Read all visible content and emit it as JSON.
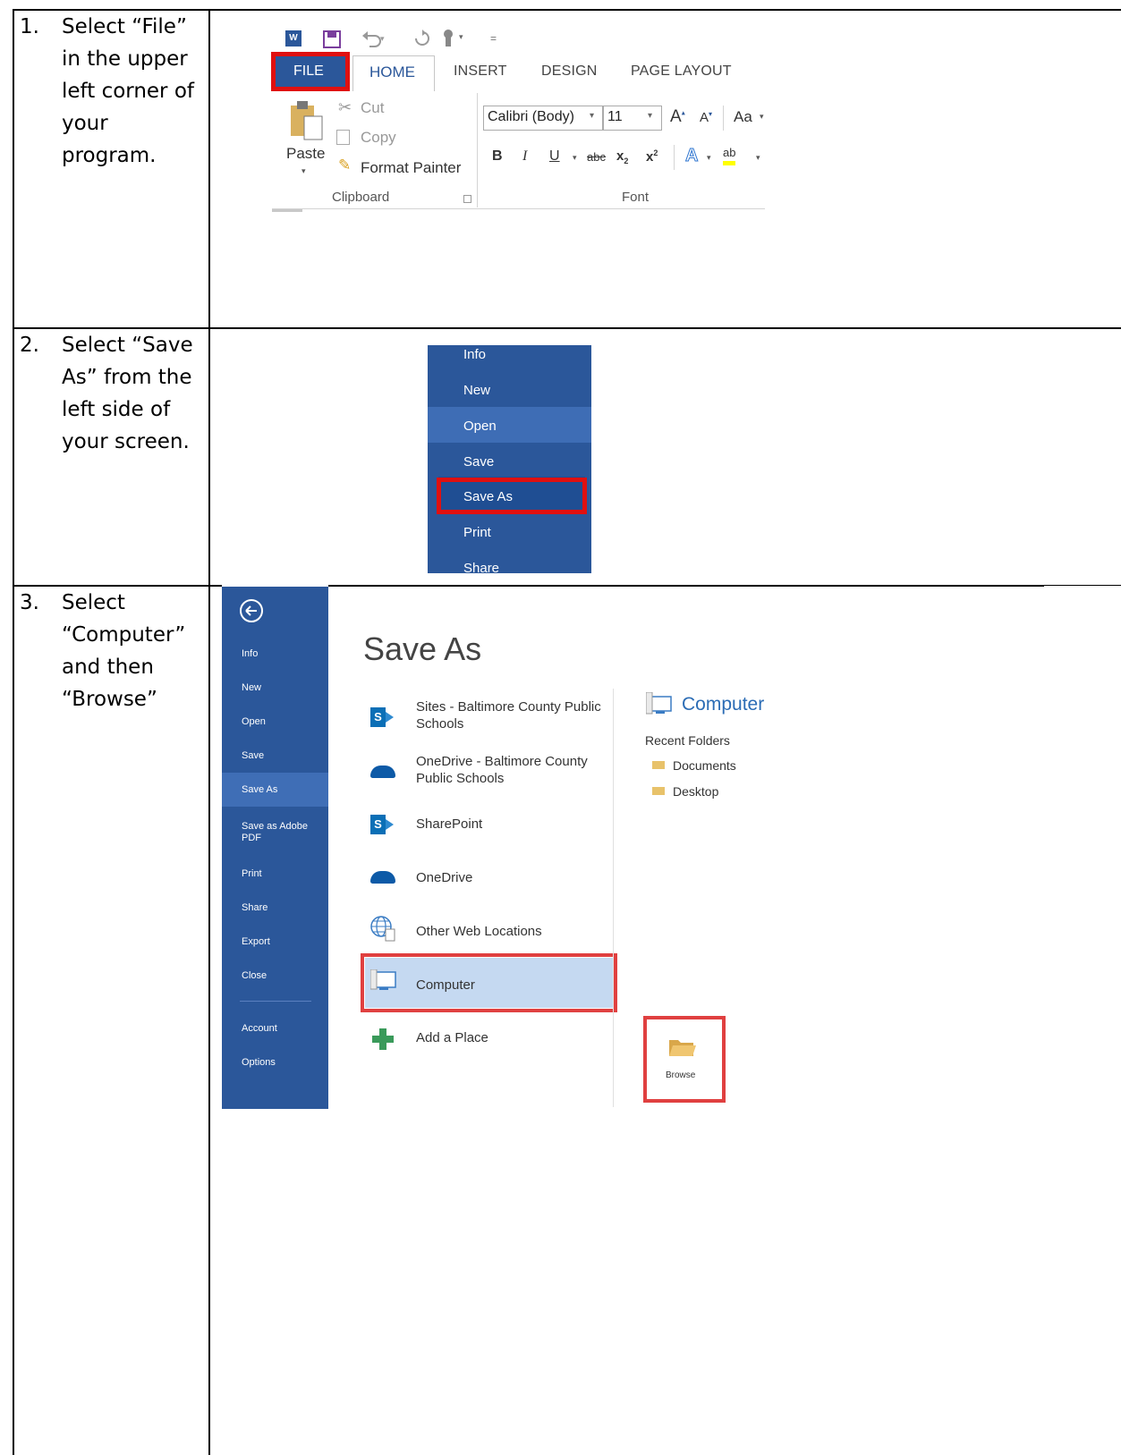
{
  "steps": [
    {
      "num": "1.",
      "text": "Select “File” in the upper left corner of your program."
    },
    {
      "num": "2.",
      "text": "Select “Save As” from the left side of your screen."
    },
    {
      "num": "3.",
      "text": "Select “Computer” and then “Browse”"
    }
  ],
  "ribbon": {
    "tabs": [
      "FILE",
      "HOME",
      "INSERT",
      "DESIGN",
      "PAGE LAYOUT"
    ],
    "clipboard": {
      "paste": "Paste",
      "cut": "Cut",
      "copy": "Copy",
      "format_painter": "Format Painter",
      "group": "Clipboard"
    },
    "font": {
      "name": "Calibri (Body)",
      "size": "11",
      "change_case": "Aa",
      "group": "Font"
    }
  },
  "file_menu": [
    "Info",
    "New",
    "Open",
    "Save",
    "Save As",
    "Print",
    "Share"
  ],
  "backstage": {
    "sidebar": [
      "Info",
      "New",
      "Open",
      "Save",
      "Save As",
      "Save as Adobe PDF",
      "Print",
      "Share",
      "Export",
      "Close",
      "Account",
      "Options"
    ],
    "title": "Save As",
    "locations": [
      "Sites - Baltimore County Public Schools",
      "OneDrive - Baltimore County Public Schools",
      "SharePoint",
      "OneDrive",
      "Other Web Locations",
      "Computer",
      "Add a Place"
    ],
    "computer_heading": "Computer",
    "recent_folders_label": "Recent Folders",
    "recent_folders": [
      "Documents",
      "Desktop"
    ],
    "browse": "Browse"
  },
  "colors": {
    "word_blue": "#2b579a",
    "highlight_red": "#e01010",
    "selected_location": "#c5d9f1"
  }
}
